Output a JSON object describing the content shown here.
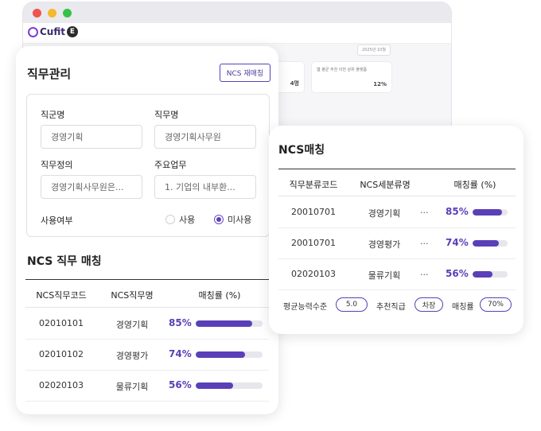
{
  "background": {
    "logo_text": "Cufit",
    "logo_badge": "E",
    "card1_num": "4명",
    "card2_text": "웹 평균 추천 이전 상위 플랫폼",
    "card2_num": "12%",
    "mini_button": "2025년 10월"
  },
  "job_management": {
    "title": "직무관리",
    "rematch_button": "NCS 재매칭",
    "form": {
      "job_group_label": "직군명",
      "job_group_value": "경영기획",
      "job_name_label": "직무명",
      "job_name_value": "경영기획사무원",
      "job_def_label": "직무정의",
      "job_def_value": "경영기획사무원은...",
      "main_duty_label": "주요업무",
      "main_duty_value": "1. 기업의 내부환...",
      "usage_label": "사용여부",
      "usage_options": [
        "사용",
        "미사용"
      ],
      "usage_selected": "미사용"
    },
    "ncs_section": {
      "title": "NCS 직무 매칭",
      "headers": [
        "NCS직무코드",
        "NCS직무명",
        "매칭률 (%)"
      ],
      "rows": [
        {
          "code": "02010101",
          "name": "경영기획",
          "pct_label": "85%",
          "pct": 85
        },
        {
          "code": "02010102",
          "name": "경영평가",
          "pct_label": "74%",
          "pct": 74
        },
        {
          "code": "02020103",
          "name": "물류기획",
          "pct_label": "56%",
          "pct": 56
        }
      ]
    }
  },
  "ncs_matching": {
    "title": "NCS매칭",
    "headers": [
      "직무분류코드",
      "NCS세분류명",
      "매칭률 (%)"
    ],
    "rows": [
      {
        "code": "20010701",
        "name": "경영기획",
        "dots": "...",
        "pct_label": "85%",
        "pct": 85
      },
      {
        "code": "20010701",
        "name": "경영평가",
        "dots": "...",
        "pct_label": "74%",
        "pct": 74
      },
      {
        "code": "02020103",
        "name": "물류기획",
        "dots": "...",
        "pct_label": "56%",
        "pct": 56
      }
    ],
    "footer": {
      "avg_label": "평균능력수준",
      "avg_value": "5.0",
      "rec_label": "추천직급",
      "rec_value": "차장",
      "match_label": "매칭률",
      "match_value": "70%"
    }
  },
  "colors": {
    "accent": "#5a3fb8",
    "bar_track": "#e6e6ec"
  }
}
